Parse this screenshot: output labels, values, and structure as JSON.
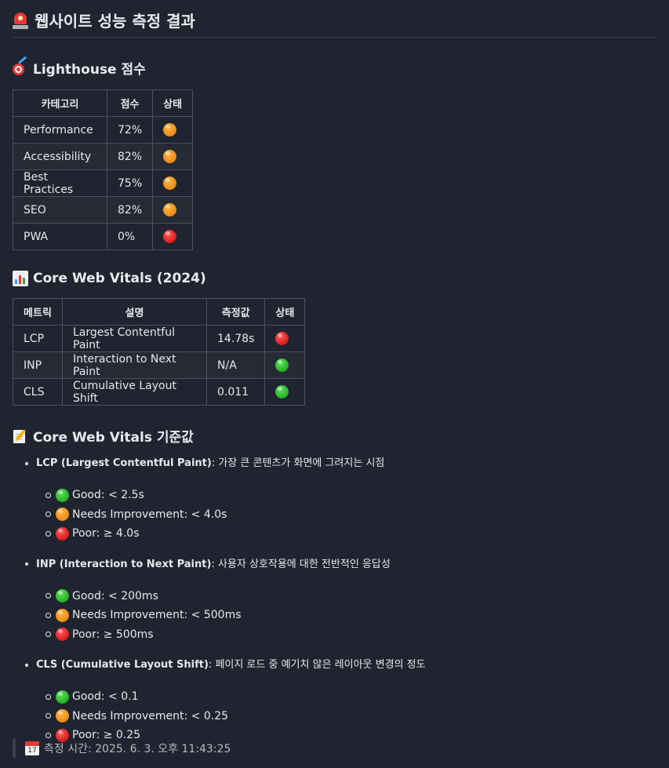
{
  "title": "웹사이트 성능 측정 결과",
  "lighthouse": {
    "heading": "Lighthouse 점수",
    "headers": [
      "카테고리",
      "점수",
      "상태"
    ],
    "rows": [
      {
        "category": "Performance",
        "score": "72%",
        "status": "orange"
      },
      {
        "category": "Accessibility",
        "score": "82%",
        "status": "orange"
      },
      {
        "category": "Best Practices",
        "score": "75%",
        "status": "orange"
      },
      {
        "category": "SEO",
        "score": "82%",
        "status": "orange"
      },
      {
        "category": "PWA",
        "score": "0%",
        "status": "red"
      }
    ]
  },
  "cwv": {
    "heading": "Core Web Vitals (2024)",
    "headers": [
      "메트릭",
      "설명",
      "측정값",
      "상태"
    ],
    "rows": [
      {
        "metric": "LCP",
        "description": "Largest Contentful Paint",
        "value": "14.78s",
        "status": "red"
      },
      {
        "metric": "INP",
        "description": "Interaction to Next Paint",
        "value": "N/A",
        "status": "green"
      },
      {
        "metric": "CLS",
        "description": "Cumulative Layout Shift",
        "value": "0.011",
        "status": "green"
      }
    ]
  },
  "thresholds": {
    "heading": "Core Web Vitals 기준값",
    "items": [
      {
        "name": "LCP (Largest Contentful Paint)",
        "description": "가장 큰 콘텐츠가 화면에 그려지는 시점",
        "levels": [
          {
            "status": "green",
            "text": "Good: < 2.5s"
          },
          {
            "status": "orange",
            "text": "Needs Improvement: < 4.0s"
          },
          {
            "status": "red",
            "text": "Poor: ≥ 4.0s"
          }
        ]
      },
      {
        "name": "INP (Interaction to Next Paint)",
        "description": "사용자 상호작용에 대한 전반적인 응답성",
        "levels": [
          {
            "status": "green",
            "text": "Good: < 200ms"
          },
          {
            "status": "orange",
            "text": "Needs Improvement: < 500ms"
          },
          {
            "status": "red",
            "text": "Poor: ≥ 500ms"
          }
        ]
      },
      {
        "name": "CLS (Cumulative Layout Shift)",
        "description": "페이지 로드 중 예기치 않은 레이아웃 변경의 정도",
        "levels": [
          {
            "status": "green",
            "text": "Good: < 0.1"
          },
          {
            "status": "orange",
            "text": "Needs Improvement: < 0.25"
          },
          {
            "status": "red",
            "text": "Poor: ≥ 0.25"
          }
        ]
      }
    ]
  },
  "footer": {
    "calendar_day": "17",
    "text": "측정 시간: 2025. 6. 3. 오후 11:43:25"
  },
  "icons": {
    "title": "siren-icon",
    "lighthouse": "target-icon",
    "cwv": "bar-chart-icon",
    "thresholds": "memo-icon",
    "footer": "calendar-icon"
  },
  "colors": {
    "background": "#1f2430",
    "good": "#0a9a0a",
    "needs_improvement": "#e07b00",
    "poor": "#c70000"
  }
}
